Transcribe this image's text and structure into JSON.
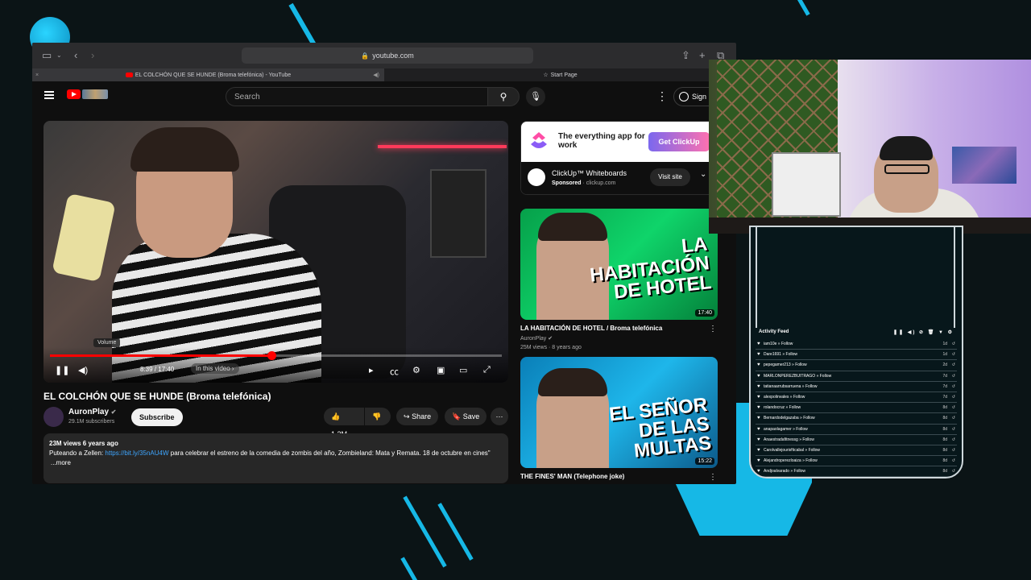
{
  "browser": {
    "url": "youtube.com",
    "tabs": [
      {
        "title": "EL COLCHÓN QUE SE HUNDE (Broma telefónica) - YouTube",
        "active": true
      },
      {
        "title": "Start Page",
        "active": false
      }
    ]
  },
  "youtube": {
    "search_placeholder": "Search",
    "sign_in_label": "Sign",
    "player": {
      "volume_tooltip": "Volume",
      "time": "8:39 / 17:40",
      "in_this_video": "In this video",
      "progress": 0.49
    },
    "video": {
      "title": "EL COLCHÓN QUE SE HUNDE (Broma telefónica)",
      "channel": "AuronPlay",
      "subscribers": "29.1M subscribers",
      "subscribe_label": "Subscribe",
      "likes": "1.2M",
      "share_label": "Share",
      "save_label": "Save",
      "views_line": "23M views  6 years ago",
      "description_prefix": "Puteando a Zellen: ",
      "description_link": "https://bit.ly/35nAU4W",
      "description_rest": " para celebrar el estreno de la comedia de zombis del año, Zombieland: Mata y Remata.  18 de octubre en cines\"",
      "more_label": "...more"
    },
    "ad": {
      "headline": "The everything app for work",
      "cta": "Get ClickUp",
      "title": "ClickUp™ Whiteboards",
      "sponsored": "Sponsored",
      "domain": "clickup.com",
      "visit_label": "Visit site"
    },
    "related": [
      {
        "thumb_text": "LA HABITACIÓN DE HOTEL",
        "duration": "17:40",
        "title": "LA HABITACIÓN DE HOTEL / Broma telefónica",
        "channel": "AuronPlay",
        "meta": "25M views · 8 years ago"
      },
      {
        "thumb_text": "EL SEÑOR DE LAS MULTAS",
        "duration": "15:22",
        "title": "THE FINES' MAN (Telephone joke)",
        "channel": "",
        "meta": ""
      }
    ]
  },
  "activity_feed": {
    "title": "Activity Feed",
    "items": [
      {
        "user": "iam10e",
        "action": "Follow",
        "ago": "1d"
      },
      {
        "user": "Dare1691",
        "action": "Follow",
        "ago": "1d"
      },
      {
        "user": "pepegamer213",
        "action": "Follow",
        "ago": "2d"
      },
      {
        "user": "MARLONPEREZBUITRAGO",
        "action": "Follow",
        "ago": "7d"
      },
      {
        "user": "tatianaarrubsarruena",
        "action": "Follow",
        "ago": "7d"
      },
      {
        "user": "alexpolinvales",
        "action": "Follow",
        "ago": "7d"
      },
      {
        "user": "rolandocruz",
        "action": "Follow",
        "ago": "8d"
      },
      {
        "user": "Bernardodelgazaba",
        "action": "Follow",
        "ago": "8d"
      },
      {
        "user": "anapaolagamer",
        "action": "Follow",
        "ago": "8d"
      },
      {
        "user": "Anaestradafitnessg",
        "action": "Follow",
        "ago": "8d"
      },
      {
        "user": "Carolvallejourisfticabal",
        "action": "Follow",
        "ago": "8d"
      },
      {
        "user": "Alejandroperezloaiza",
        "action": "Follow",
        "ago": "8d"
      },
      {
        "user": "Andjoalvarado",
        "action": "Follow",
        "ago": "8d"
      }
    ]
  },
  "colors": {
    "accent": "#16b8e6",
    "youtube_red": "#ff0000",
    "background": "#0b1416"
  }
}
